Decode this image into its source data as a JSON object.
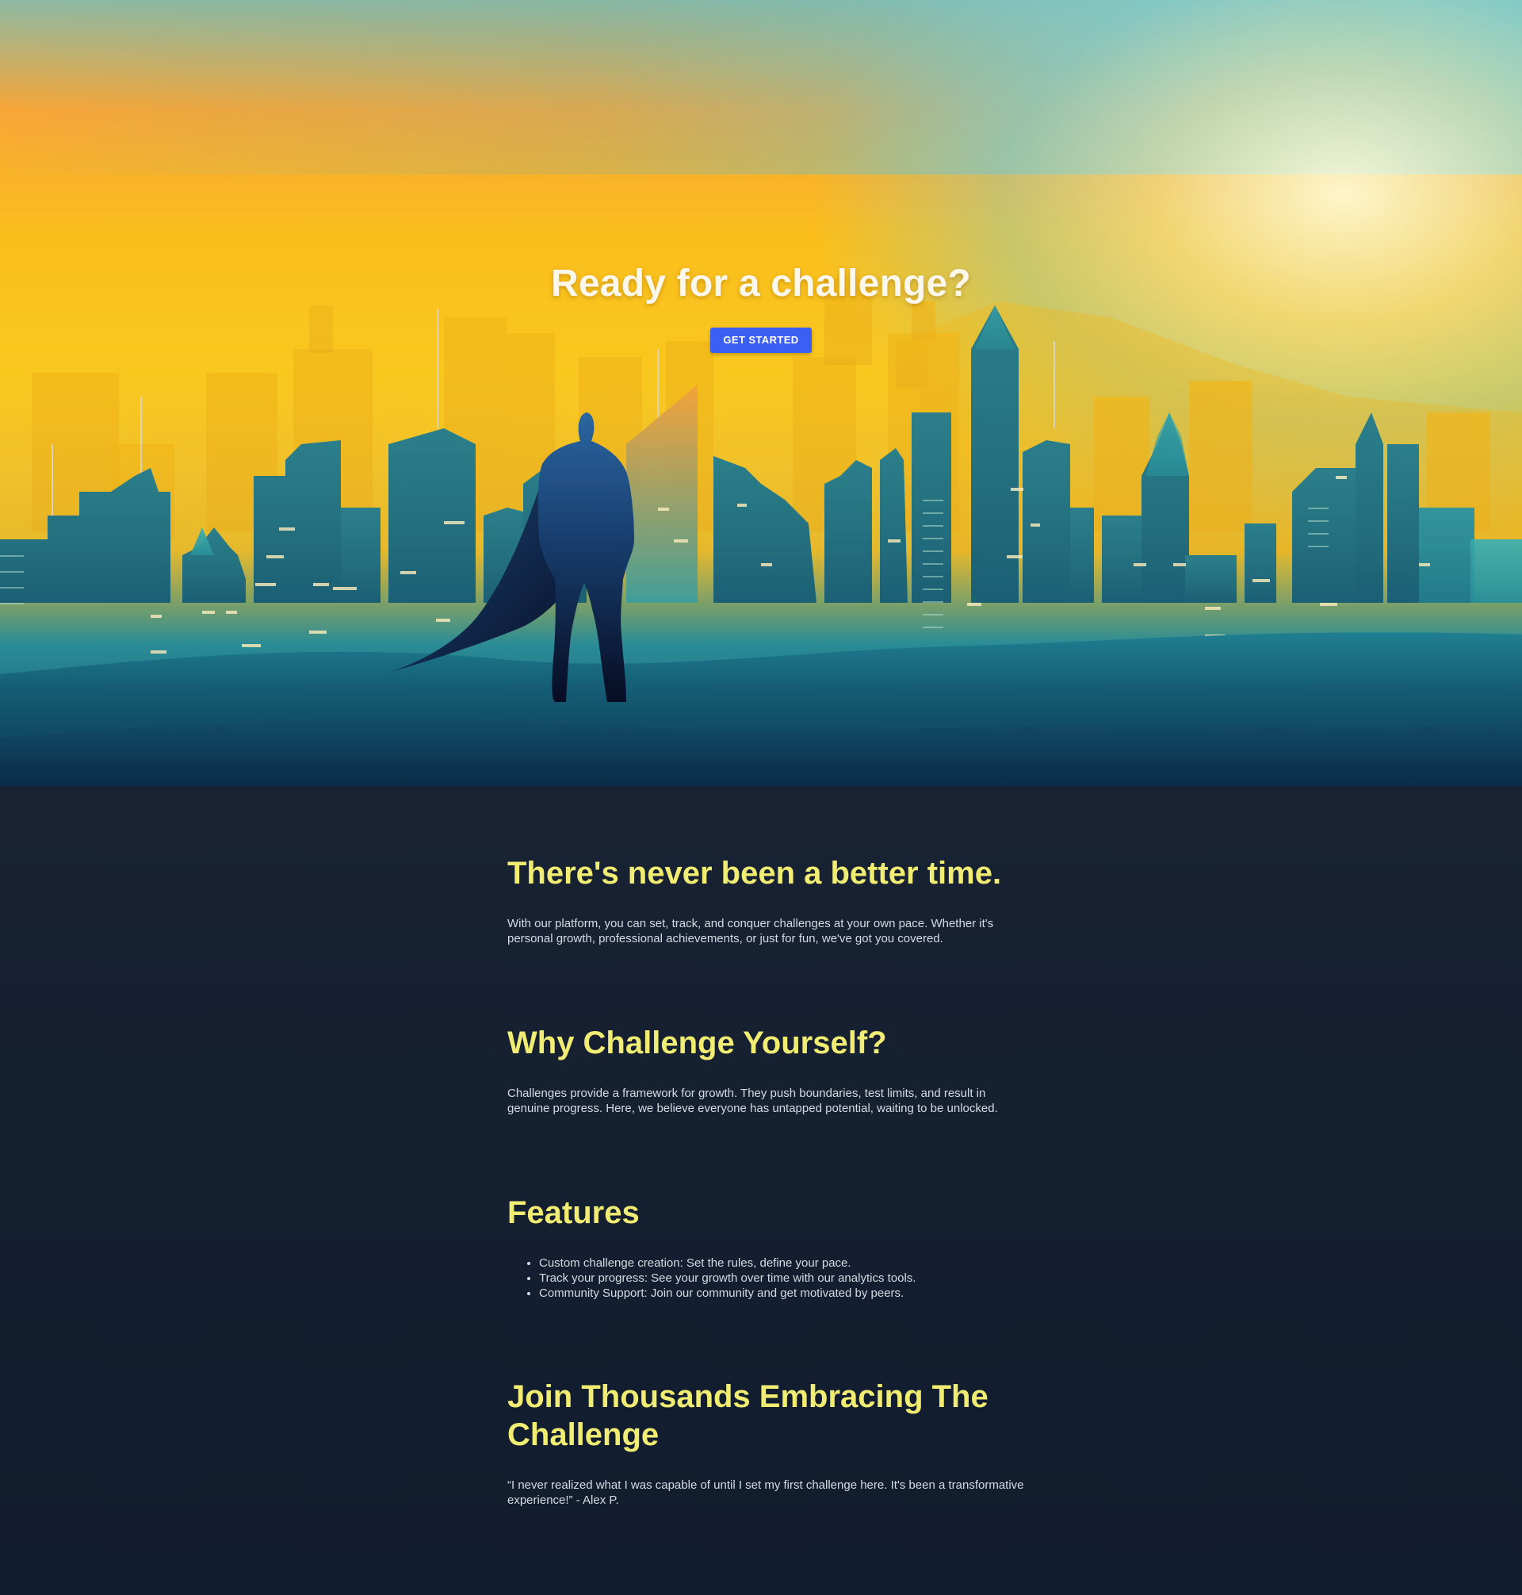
{
  "hero": {
    "title": "Ready for a challenge?",
    "cta_label": "GET STARTED",
    "image_description": "silhouette-hero-caped-figure-over-city-skyline",
    "colors": {
      "sky_gold": "#fbbe1c",
      "city_teal": "#1f6f80",
      "ground_navy": "#0d3a55",
      "button_blue": "#3b5ff3"
    }
  },
  "sections": {
    "better_time": {
      "heading": "There's never been a better time.",
      "body": "With our platform, you can set, track, and conquer challenges at your own pace. Whether it's personal growth, professional achievements, or just for fun, we've got you covered."
    },
    "why": {
      "heading": "Why Challenge Yourself?",
      "body": "Challenges provide a framework for growth. They push boundaries, test limits, and result in genuine progress. Here, we believe everyone has untapped potential, waiting to be unlocked."
    },
    "features": {
      "heading": "Features",
      "items": [
        "Custom challenge creation: Set the rules, define your pace.",
        "Track your progress: See your growth over time with our analytics tools.",
        "Community Support: Join our community and get motivated by peers."
      ]
    },
    "join": {
      "heading": "Join Thousands Embracing The Challenge",
      "quote": "“I never realized what I was capable of until I set my first challenge here. It's been a transformative experience!” - Alex P."
    }
  },
  "colors": {
    "page_background": "#111c2e",
    "heading": "#f1ec72",
    "body_text": "#d6dbe3"
  }
}
